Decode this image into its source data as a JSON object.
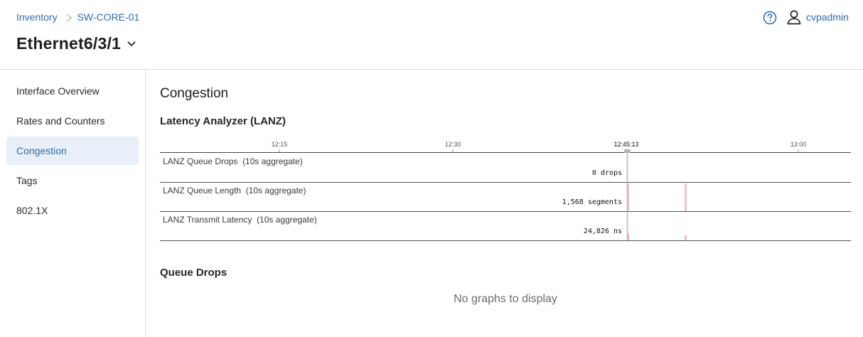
{
  "breadcrumb": {
    "items": [
      "Inventory",
      "SW-CORE-01"
    ]
  },
  "page": {
    "title": "Ethernet6/3/1"
  },
  "user": {
    "name": "cvpadmin"
  },
  "icons": {
    "help": "help-circle-icon",
    "user": "user-icon",
    "chevron": "chevron-down-icon"
  },
  "colors": {
    "accent": "#2d6cb5",
    "active_bg": "#e8eff8",
    "spike": "#f2b3b8"
  },
  "sidebar": {
    "items": [
      {
        "label": "Interface Overview",
        "active": false
      },
      {
        "label": "Rates and Counters",
        "active": false
      },
      {
        "label": "Congestion",
        "active": true
      },
      {
        "label": "Tags",
        "active": false
      },
      {
        "label": "802.1X",
        "active": false
      }
    ]
  },
  "main": {
    "section_title": "Congestion",
    "lanz_title": "Latency Analyzer (LANZ)",
    "queue_drops_title": "Queue Drops",
    "empty_message": "No graphs to display"
  },
  "chart_data": {
    "type": "timeline",
    "time_ticks": [
      "12:15",
      "12:30",
      "12:45:13",
      "13:00"
    ],
    "cursor_time": "12:45:13",
    "rows": [
      {
        "label": "LANZ Queue Drops",
        "aggregate": "(10s aggregate)",
        "value": "0 drops"
      },
      {
        "label": "LANZ Queue Length",
        "aggregate": "(10s aggregate)",
        "value": "1,568 segments"
      },
      {
        "label": "LANZ Transmit Latency",
        "aggregate": "(10s aggregate)",
        "value": "24,826 ns"
      }
    ]
  }
}
